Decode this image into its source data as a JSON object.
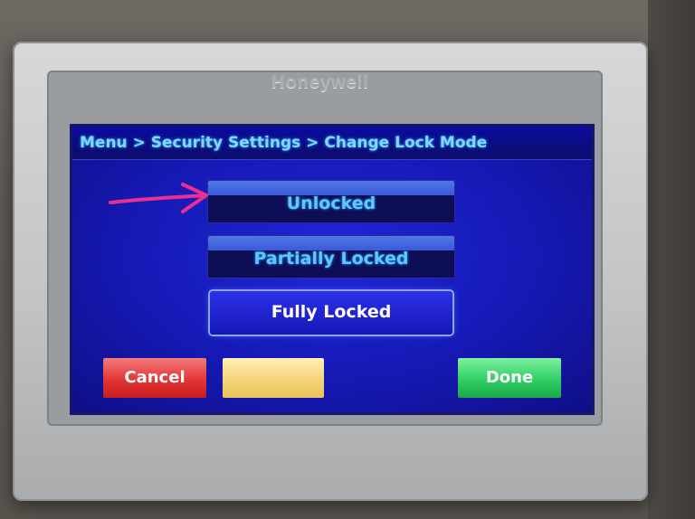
{
  "device": {
    "brand": "Honeywell"
  },
  "screen": {
    "breadcrumb": "Menu > Security Settings > Change Lock Mode",
    "options": [
      {
        "label": "Unlocked",
        "selected": false
      },
      {
        "label": "Partially Locked",
        "selected": false
      },
      {
        "label": "Fully Locked",
        "selected": true
      }
    ],
    "buttons": {
      "cancel": "Cancel",
      "middle": "",
      "done": "Done"
    }
  },
  "annotation": {
    "icon": "pink-hand-drawn-arrow-icon",
    "color": "#e8318f"
  },
  "colors": {
    "screen_bg": "#1619b4",
    "text_cyan": "#5fc6ff",
    "cancel": "#e23636",
    "middle": "#f5d47a",
    "done": "#2fcf64"
  }
}
